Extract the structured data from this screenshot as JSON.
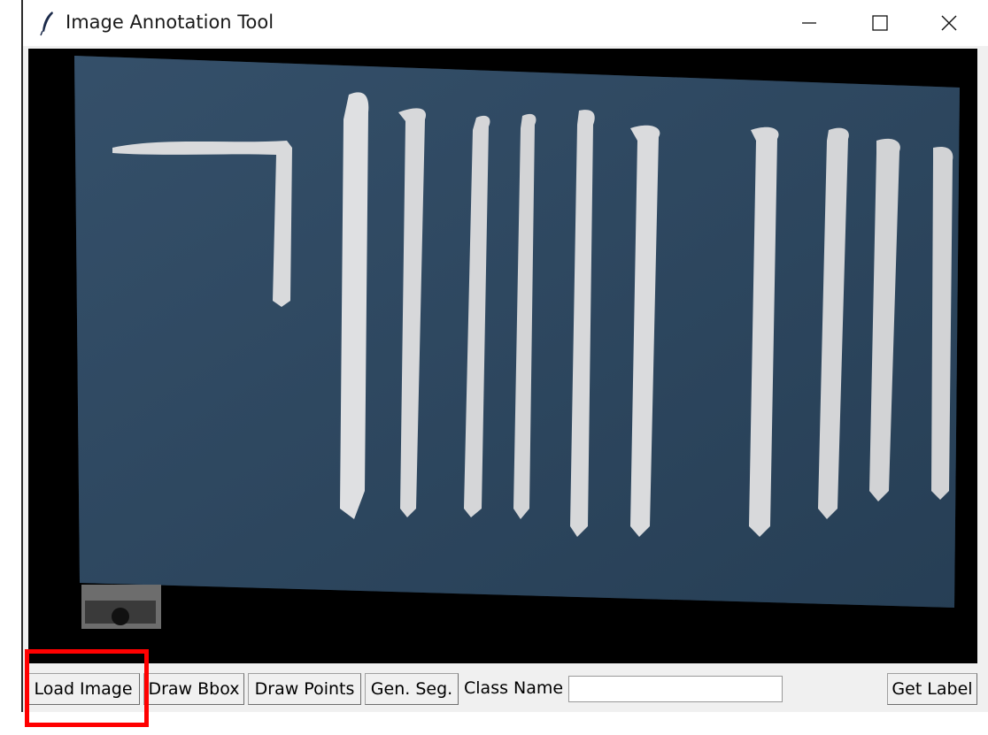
{
  "window": {
    "title": "Image Annotation Tool",
    "icon": "feather-icon",
    "controls": [
      "minimize-icon",
      "maximize-icon",
      "close-icon"
    ]
  },
  "canvas": {
    "image_description_icon": "loaded-image",
    "background_color": "#000000",
    "board_color": "#2f4a63"
  },
  "toolbar": {
    "load_image_label": "Load Image",
    "draw_bbox_label": "Draw Bbox",
    "draw_points_label": "Draw Points",
    "gen_seg_label": "Gen. Seg.",
    "class_name_label": "Class Name",
    "class_name_value": "",
    "get_label_label": "Get Label"
  },
  "annotation": {
    "highlight_color": "#ff0000"
  }
}
